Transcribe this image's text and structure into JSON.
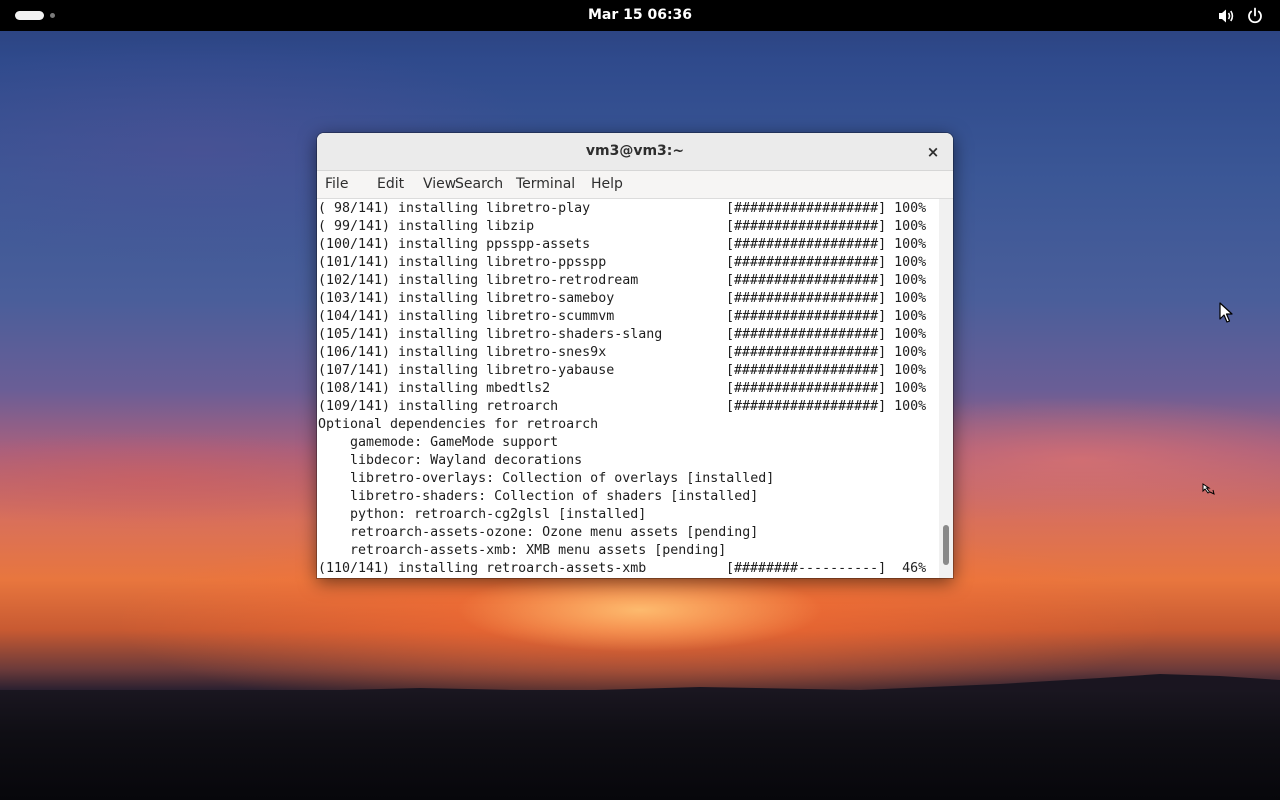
{
  "topbar": {
    "clock": "Mar 15  06:36",
    "icons": [
      "activities-indicator",
      "volume-icon",
      "power-icon"
    ]
  },
  "window": {
    "title": "vm3@vm3:~",
    "close_label": "×",
    "menu": [
      "File",
      "Edit",
      "View",
      "Search",
      "Terminal",
      "Help"
    ]
  },
  "terminal": {
    "lines": [
      {
        "text": "( 98/141) installing libretro-play",
        "progress": "[##################] 100%"
      },
      {
        "text": "( 99/141) installing libzip",
        "progress": "[##################] 100%"
      },
      {
        "text": "(100/141) installing ppsspp-assets",
        "progress": "[##################] 100%"
      },
      {
        "text": "(101/141) installing libretro-ppsspp",
        "progress": "[##################] 100%"
      },
      {
        "text": "(102/141) installing libretro-retrodream",
        "progress": "[##################] 100%"
      },
      {
        "text": "(103/141) installing libretro-sameboy",
        "progress": "[##################] 100%"
      },
      {
        "text": "(104/141) installing libretro-scummvm",
        "progress": "[##################] 100%"
      },
      {
        "text": "(105/141) installing libretro-shaders-slang",
        "progress": "[##################] 100%"
      },
      {
        "text": "(106/141) installing libretro-snes9x",
        "progress": "[##################] 100%"
      },
      {
        "text": "(107/141) installing libretro-yabause",
        "progress": "[##################] 100%"
      },
      {
        "text": "(108/141) installing mbedtls2",
        "progress": "[##################] 100%"
      },
      {
        "text": "(109/141) installing retroarch",
        "progress": "[##################] 100%"
      },
      {
        "text": "Optional dependencies for retroarch",
        "progress": ""
      },
      {
        "text": "    gamemode: GameMode support",
        "progress": ""
      },
      {
        "text": "    libdecor: Wayland decorations",
        "progress": ""
      },
      {
        "text": "    libretro-overlays: Collection of overlays [installed]",
        "progress": ""
      },
      {
        "text": "    libretro-shaders: Collection of shaders [installed]",
        "progress": ""
      },
      {
        "text": "    python: retroarch-cg2glsl [installed]",
        "progress": ""
      },
      {
        "text": "    retroarch-assets-ozone: Ozone menu assets [pending]",
        "progress": ""
      },
      {
        "text": "    retroarch-assets-xmb: XMB menu assets [pending]",
        "progress": ""
      },
      {
        "text": "(110/141) installing retroarch-assets-xmb",
        "progress": "[########----------]  46%"
      }
    ],
    "scroll_position": 0.97
  }
}
